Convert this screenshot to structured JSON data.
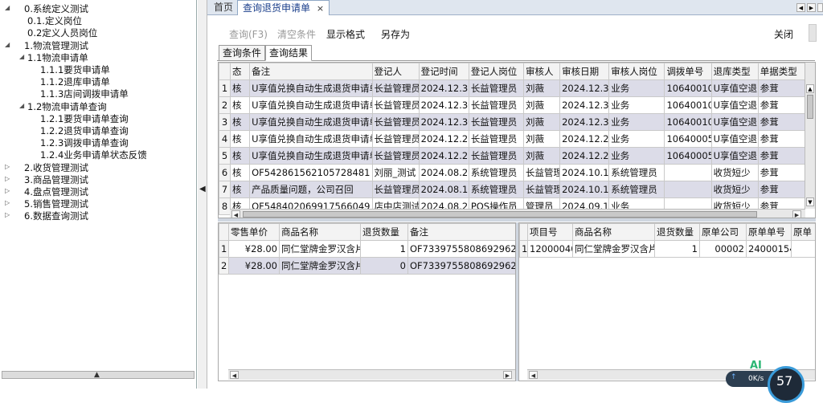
{
  "tree": [
    {
      "label": "0.系统定义测试",
      "level": 0,
      "expanded": true
    },
    {
      "label": "0.1.定义岗位",
      "level": 1
    },
    {
      "label": "0.2定义人员岗位",
      "level": 1
    },
    {
      "label": "1.物流管理测试",
      "level": 0,
      "expanded": true
    },
    {
      "label": "1.1物流申请单",
      "level": 1,
      "expanded": true
    },
    {
      "label": "1.1.1要货申请单",
      "level": 2
    },
    {
      "label": "1.1.2退库申请单",
      "level": 2
    },
    {
      "label": "1.1.3店间调拨申请单",
      "level": 2
    },
    {
      "label": "1.2物流申请单查询",
      "level": 1,
      "expanded": true
    },
    {
      "label": "1.2.1要货申请单查询",
      "level": 2
    },
    {
      "label": "1.2.2退货申请单查询",
      "level": 2
    },
    {
      "label": "1.2.3调拨申请单查询",
      "level": 2
    },
    {
      "label": "1.2.4业务申请单状态反馈",
      "level": 2
    },
    {
      "label": "2.收货管理测试",
      "level": 0,
      "expanded": false
    },
    {
      "label": "3.商品管理测试",
      "level": 0,
      "expanded": false
    },
    {
      "label": "4.盘点管理测试",
      "level": 0,
      "expanded": false
    },
    {
      "label": "5.销售管理测试",
      "level": 0,
      "expanded": false
    },
    {
      "label": "6.数据查询测试",
      "level": 0,
      "expanded": false
    }
  ],
  "tabs": {
    "home": "首页",
    "active": "查询退货申请单",
    "close": "×"
  },
  "toolbar": {
    "query": "查询(F3)",
    "clear": "清空条件",
    "format": "显示格式",
    "save_as": "另存为",
    "close": "关闭"
  },
  "subtabs": {
    "conditions": "查询条件",
    "results": "查询结果"
  },
  "main_grid": {
    "headers": [
      "态",
      "备注",
      "登记人",
      "登记时间",
      "登记人岗位",
      "审核人",
      "审核日期",
      "审核人岗位",
      "调拨单号",
      "退库类型",
      "单据类型"
    ],
    "rows": [
      [
        "1",
        "核",
        "U享值兑换自动生成退货申请单",
        "长益管理员",
        "2024.12.31",
        "长益管理员",
        "刘薇",
        "2024.12.31",
        "业务",
        "106400104",
        "U享值空退",
        "参茸"
      ],
      [
        "2",
        "核",
        "U享值兑换自动生成退货申请单",
        "长益管理员",
        "2024.12.30",
        "长益管理员",
        "刘薇",
        "2024.12.30",
        "业务",
        "106400105",
        "U享值空退",
        "参茸"
      ],
      [
        "3",
        "核",
        "U享值兑换自动生成退货申请单",
        "长益管理员",
        "2024.12.30",
        "长益管理员",
        "刘薇",
        "2024.12.30",
        "业务",
        "106400101",
        "U享值空退",
        "参茸"
      ],
      [
        "4",
        "核",
        "U享值兑换自动生成退货申请单",
        "长益管理员",
        "2024.12.23",
        "长益管理员",
        "刘薇",
        "2024.12.23",
        "业务",
        "106400055",
        "U享值空退",
        "参茸"
      ],
      [
        "5",
        "核",
        "U享值兑换自动生成退货申请单",
        "长益管理员",
        "2024.12.23",
        "长益管理员",
        "刘薇",
        "2024.12.23",
        "业务",
        "106400052",
        "U享值空退",
        "参茸"
      ],
      [
        "6",
        "核",
        "OF542861562105728481",
        "刘丽_测试",
        "2024.08.28",
        "系统管理员",
        "长益管理",
        "2024.10.16",
        "系统管理员",
        "",
        "收货短少",
        "参茸"
      ],
      [
        "7",
        "核",
        "产品质量问题，公司召回",
        "长益管理员",
        "2024.08.16",
        "系统管理员",
        "长益管理",
        "2024.10.16",
        "系统管理员",
        "",
        "收货短少",
        "参茸"
      ],
      [
        "8",
        "核",
        "OF548402069917566049",
        "店中店测试",
        "2024.08.28",
        "POS操作员",
        "管理员",
        "2024.09.13",
        "业务",
        "",
        "收货短少",
        "参茸"
      ]
    ]
  },
  "left_grid": {
    "headers": [
      "零售单价",
      "商品名称",
      "退货数量",
      "备注"
    ],
    "rows": [
      [
        "1",
        "¥28.00",
        "同仁堂牌金罗汉含片",
        "1",
        "OF733975580869296246"
      ],
      [
        "2",
        "¥28.00",
        "同仁堂牌金罗汉含片",
        "0",
        "OF733975580869296246"
      ]
    ]
  },
  "right_grid": {
    "headers": [
      "项目号",
      "商品名称",
      "退货数量",
      "原单公司",
      "原单单号",
      "原单"
    ],
    "rows": [
      [
        "1",
        "12000040",
        "同仁堂牌金罗汉含片",
        "1",
        "00002",
        "24000154",
        ""
      ]
    ]
  },
  "status": {
    "ai": "AI",
    "speed": "0K/s",
    "percent": "57"
  },
  "colors": {
    "alt_row": "#dcdce8",
    "tab_active": "#1b3f8b"
  }
}
